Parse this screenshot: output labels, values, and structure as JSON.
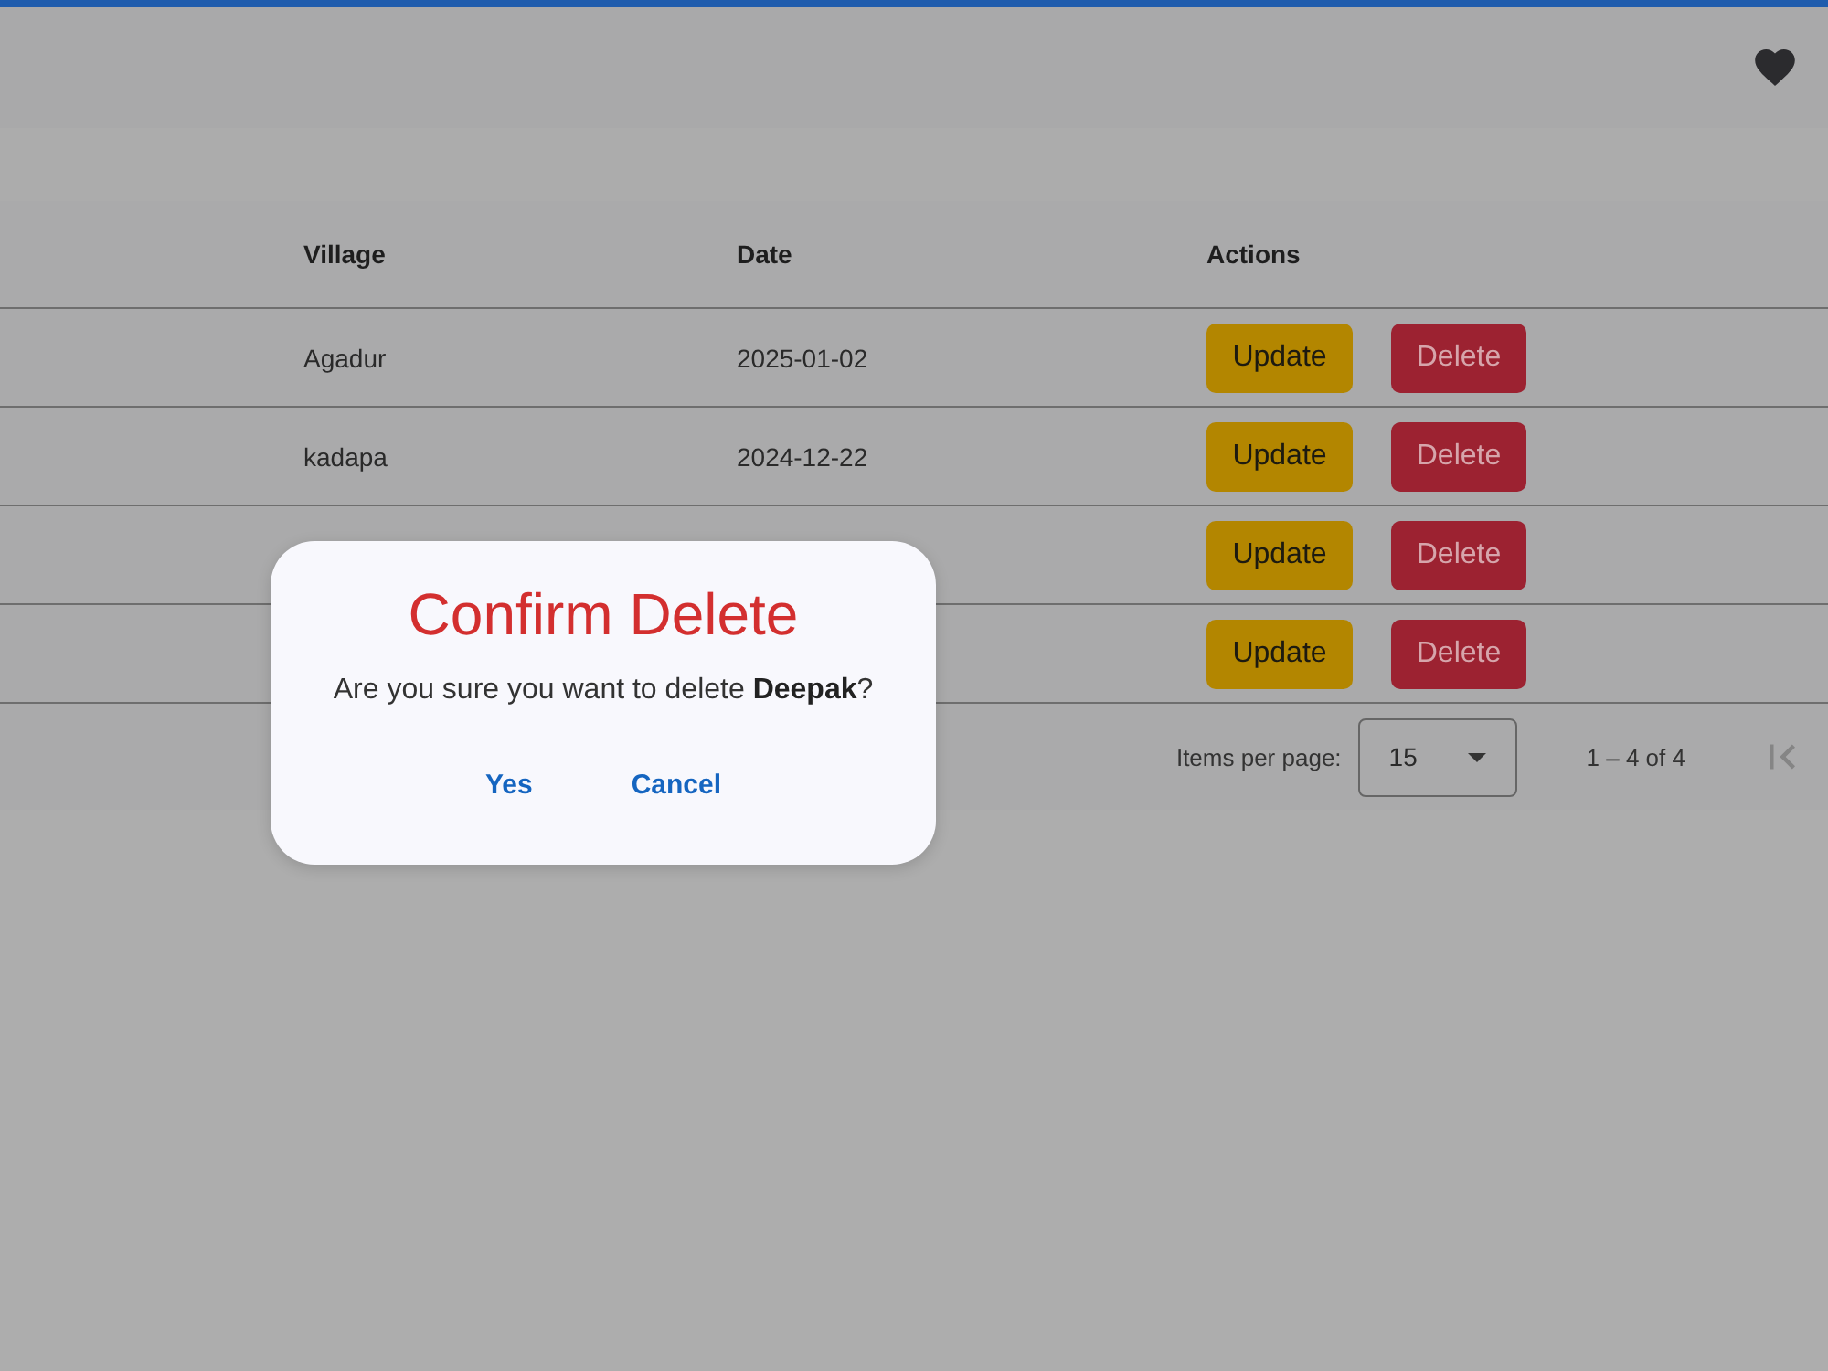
{
  "table": {
    "columns": [
      "Village",
      "Date",
      "Actions"
    ],
    "rows": [
      {
        "village": "Agadur",
        "date": "2025-01-02",
        "actions": [
          {
            "kind": "update",
            "label": "Update"
          },
          {
            "kind": "delete",
            "label": "Delete"
          }
        ]
      },
      {
        "village": "kadapa",
        "date": "2024-12-22",
        "actions": [
          {
            "kind": "update",
            "label": "Update"
          },
          {
            "kind": "delete",
            "label": "Delete"
          }
        ]
      },
      {
        "actions": [
          {
            "kind": "update",
            "label": "Update"
          },
          {
            "kind": "delete",
            "label": "Delete"
          }
        ]
      },
      {
        "actions": [
          {
            "kind": "update",
            "label": "Update"
          },
          {
            "kind": "delete",
            "label": "Delete"
          }
        ]
      }
    ]
  },
  "paginator": {
    "label": "Items per page:",
    "page_size": "15",
    "range": "1 – 4 of 4",
    "first_page": {
      "disabled": true
    }
  },
  "dialog": {
    "title": "Confirm Delete",
    "message": "Are you sure you want to delete **Deepak**?",
    "buttons": [
      "Yes",
      "Cancel"
    ]
  }
}
